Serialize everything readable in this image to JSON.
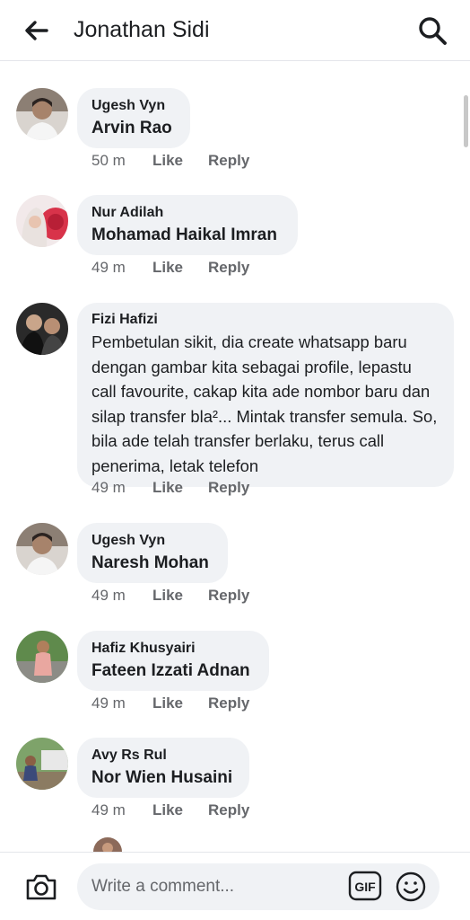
{
  "header": {
    "title": "Jonathan Sidi",
    "back_icon": "arrow-left-icon",
    "search_icon": "search-icon"
  },
  "comments": [
    {
      "author": "Ugesh Vyn",
      "text": "Arvin Rao",
      "time": "50 m",
      "like": "Like",
      "reply": "Reply"
    },
    {
      "author": "Nur Adilah",
      "text": "Mohamad Haikal Imran",
      "time": "49 m",
      "like": "Like",
      "reply": "Reply"
    },
    {
      "author": "Fizi Hafizi",
      "text": "Pembetulan sikit, dia create whatsapp baru dengan gambar kita sebagai profile, lepastu call favourite, cakap kita ade nombor baru dan silap transfer bla²... Mintak transfer semula. So, bila ade telah transfer berlaku, terus call penerima, letak telefon",
      "time": "49 m",
      "like": "Like",
      "reply": "Reply"
    },
    {
      "author": "Ugesh Vyn",
      "text": "Naresh Mohan",
      "time": "49 m",
      "like": "Like",
      "reply": "Reply"
    },
    {
      "author": "Hafiz Khusyairi",
      "text": "Fateen Izzati Adnan",
      "time": "49 m",
      "like": "Like",
      "reply": "Reply"
    },
    {
      "author": "Avy Rs Rul",
      "text": "Nor Wien Husaini",
      "time": "49 m",
      "like": "Like",
      "reply": "Reply"
    }
  ],
  "composer": {
    "placeholder": "Write a comment...",
    "gif_label": "GIF",
    "camera_icon": "camera-icon",
    "emoji_icon": "smiley-icon"
  },
  "colors": {
    "bubble": "#f0f2f5",
    "meta": "#65676b",
    "text": "#1c1e21"
  }
}
